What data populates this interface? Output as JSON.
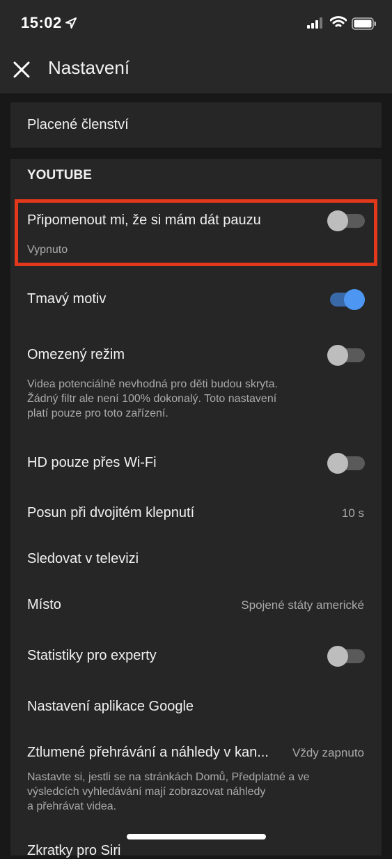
{
  "status_bar": {
    "time": "15:02",
    "icons": [
      "location-arrow-icon",
      "cellular-signal-icon",
      "wifi-icon",
      "battery-icon"
    ]
  },
  "app_bar": {
    "close_icon": "close-icon",
    "title": "Nastavení"
  },
  "premium": {
    "label": "Placené členství"
  },
  "youtube_section": {
    "header": "YOUTUBE",
    "remind_break": {
      "label": "Připomenout mi, že si mám dát pauzu",
      "sub": "Vypnuto",
      "toggle_on": false
    },
    "dark_theme": {
      "label": "Tmavý motiv",
      "toggle_on": true
    },
    "restricted_mode": {
      "label": "Omezený režim",
      "sub_lines": [
        "Videa potenciálně nevhodná pro děti budou skryta.",
        "Žádný filtr ale není 100% dokonalý. Toto nastavení",
        "platí pouze pro toto zařízení."
      ],
      "toggle_on": false
    },
    "hd_wifi": {
      "label": "HD pouze přes Wi-Fi",
      "toggle_on": false
    },
    "double_tap": {
      "label": "Posun při dvojitém klepnutí",
      "value": "10 s"
    },
    "watch_tv": {
      "label": "Sledovat v televizi"
    },
    "location": {
      "label": "Místo",
      "value": "Spojené státy americké"
    },
    "stats_nerds": {
      "label": "Statistiky pro experty",
      "toggle_on": false
    },
    "google_app": {
      "label": "Nastavení aplikace Google"
    },
    "muted_playback": {
      "label": "Ztlumené přehrávání a náhledy v kan...",
      "value": "Vždy zapnuto",
      "sub_lines": [
        "Nastavte si, jestli se na stránkách Domů, Předplatné a ve",
        "výsledcích vyhledávání mají zobrazovat náhledy",
        "a přehrávat videa."
      ]
    },
    "next_partial": {
      "label": "Zkratky pro Siri"
    }
  },
  "colors": {
    "background": "#181818",
    "card": "#262626",
    "bar": "#282828",
    "toggle_on": "#4d96f2",
    "highlight_border": "#e2381b"
  }
}
